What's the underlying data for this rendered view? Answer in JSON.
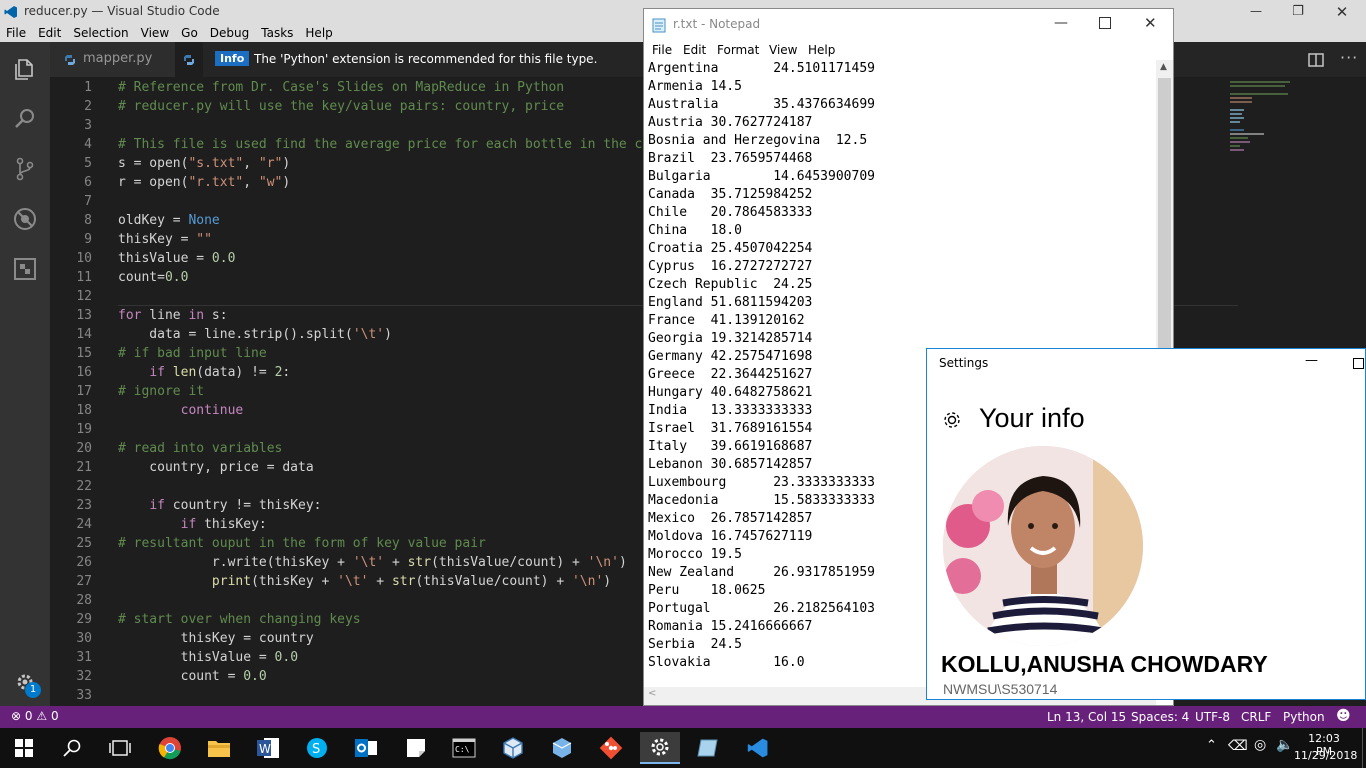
{
  "vscode": {
    "title": "reducer.py — Visual Studio Code",
    "menu": [
      "File",
      "Edit",
      "Selection",
      "View",
      "Go",
      "Debug",
      "Tasks",
      "Help"
    ],
    "tab_label": "mapper.py",
    "notification_badge": "Info",
    "notification_text": "The 'Python' extension is recommended for this file type.",
    "code_lines": [
      {
        "n": "1",
        "t": "# Reference from Dr. Case's Slides on MapReduce in Python"
      },
      {
        "n": "2",
        "t": "# reducer.py will use the key/value pairs: country, price"
      },
      {
        "n": "3",
        "t": ""
      },
      {
        "n": "4",
        "t": "# This file is used find the average price for each bottle in the co"
      },
      {
        "n": "5",
        "t": "s = open(\"s.txt\", \"r\")"
      },
      {
        "n": "6",
        "t": "r = open(\"r.txt\", \"w\")"
      },
      {
        "n": "7",
        "t": ""
      },
      {
        "n": "8",
        "t": "oldKey = None"
      },
      {
        "n": "9",
        "t": "thisKey = \"\""
      },
      {
        "n": "10",
        "t": "thisValue = 0.0"
      },
      {
        "n": "11",
        "t": "count=0.0"
      },
      {
        "n": "12",
        "t": ""
      },
      {
        "n": "13",
        "t": "for line in s:"
      },
      {
        "n": "14",
        "t": "    data = line.strip().split('\\t')"
      },
      {
        "n": "15",
        "t": "# if bad input line"
      },
      {
        "n": "16",
        "t": "    if len(data) != 2:"
      },
      {
        "n": "17",
        "t": "# ignore it"
      },
      {
        "n": "18",
        "t": "        continue"
      },
      {
        "n": "19",
        "t": ""
      },
      {
        "n": "20",
        "t": "# read into variables"
      },
      {
        "n": "21",
        "t": "    country, price = data"
      },
      {
        "n": "22",
        "t": ""
      },
      {
        "n": "23",
        "t": "    if country != thisKey:"
      },
      {
        "n": "24",
        "t": "        if thisKey:"
      },
      {
        "n": "25",
        "t": "# resultant ouput in the form of key value pair"
      },
      {
        "n": "26",
        "t": "            r.write(thisKey + '\\t' + str(thisValue/count) + '\\n')"
      },
      {
        "n": "27",
        "t": "            print(thisKey + '\\t' + str(thisValue/count) + '\\n')"
      },
      {
        "n": "28",
        "t": ""
      },
      {
        "n": "29",
        "t": "# start over when changing keys"
      },
      {
        "n": "30",
        "t": "        thisKey = country"
      },
      {
        "n": "31",
        "t": "        thisValue = 0.0"
      },
      {
        "n": "32",
        "t": "        count = 0.0"
      },
      {
        "n": "33",
        "t": ""
      }
    ],
    "status": {
      "errors": "0",
      "warnings": "0",
      "position": "Ln 13, Col 15",
      "spaces": "Spaces: 4",
      "encoding": "UTF-8",
      "eol": "CRLF",
      "language": "Python",
      "settings_badge": "1"
    },
    "colors": {
      "status_bar": "#68217a",
      "activity_bar": "#333333",
      "editor_bg": "#1e1e1e"
    }
  },
  "notepad": {
    "title": "r.txt - Notepad",
    "menu": [
      "File",
      "Edit",
      "Format",
      "View",
      "Help"
    ],
    "lines": [
      "Argentina       24.5101171459",
      "Armenia 14.5",
      "Australia       35.4376634699",
      "Austria 30.7627724187",
      "Bosnia and Herzegovina  12.5",
      "Brazil  23.7659574468",
      "Bulgaria        14.6453900709",
      "Canada  35.7125984252",
      "Chile   20.7864583333",
      "China   18.0",
      "Croatia 25.4507042254",
      "Cyprus  16.2727272727",
      "Czech Republic  24.25",
      "England 51.6811594203",
      "France  41.139120162",
      "Georgia 19.3214285714",
      "Germany 42.2575471698",
      "Greece  22.3644251627",
      "Hungary 40.6482758621",
      "India   13.3333333333",
      "Israel  31.7689161554",
      "Italy   39.6619168687",
      "Lebanon 30.6857142857",
      "Luxembourg      23.3333333333",
      "Macedonia       15.5833333333",
      "Mexico  26.7857142857",
      "Moldova 16.7457627119",
      "Morocco 19.5",
      "New Zealand     26.9317851959",
      "Peru    18.0625",
      "Portugal        26.2182564103",
      "Romania 15.2416666667",
      "Serbia  24.5",
      "Slovakia        16.0"
    ]
  },
  "settings": {
    "window_title": "Settings",
    "heading": "Your info",
    "user_name": "KOLLU,ANUSHA CHOWDARY",
    "account": "NWMSU\\S530714"
  },
  "taskbar": {
    "time": "12:03 PM",
    "date": "11/29/2018"
  }
}
